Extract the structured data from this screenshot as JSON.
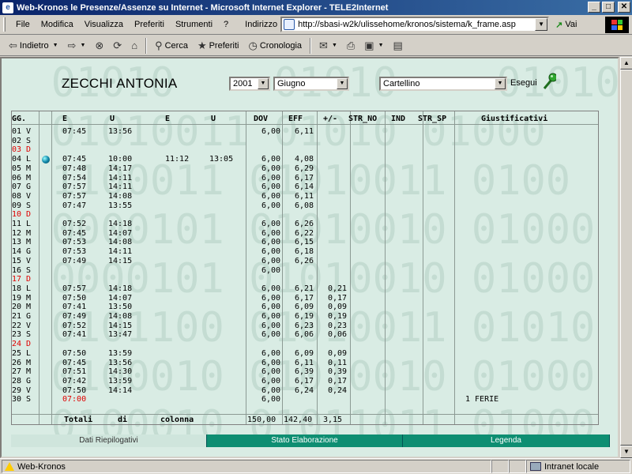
{
  "window": {
    "title": "Web-Kronos le Presenze/Assenze su Internet - Microsoft Internet Explorer - TELE2Internet",
    "min": "_",
    "max": "□",
    "close": "✕"
  },
  "menu": {
    "items": [
      "File",
      "Modifica",
      "Visualizza",
      "Preferiti",
      "Strumenti",
      "?"
    ],
    "address_label": "Indirizzo",
    "address_value": "http://sbasi-w2k/ulissehome/kronos/sistema/k_frame.asp",
    "go_label": "Vai"
  },
  "toolbar": {
    "back": "Indietro",
    "search": "Cerca",
    "favorites": "Preferiti",
    "history": "Cronologia"
  },
  "header": {
    "employee": "ZECCHI ANTONIA",
    "year": "2001",
    "month": "Giugno",
    "report": "Cartellino",
    "run": "Esegui"
  },
  "columns": [
    "GG.",
    "E",
    "U",
    "E",
    "U",
    "DOV",
    "EFF",
    "+/-",
    "STR_NO",
    "IND",
    "STR_SP",
    "Giustificativi"
  ],
  "rows": [
    {
      "gg": "01 V",
      "red": false,
      "e1": "07:45",
      "u1": "13:56",
      "e2": "",
      "u2": "",
      "dov": "6,00",
      "eff": "6,11",
      "diff": "",
      "giust": ""
    },
    {
      "gg": "02 S",
      "red": false,
      "e1": "",
      "u1": "",
      "e2": "",
      "u2": "",
      "dov": "",
      "eff": "",
      "diff": "",
      "giust": ""
    },
    {
      "gg": "03 D",
      "red": true,
      "e1": "",
      "u1": "",
      "e2": "",
      "u2": "",
      "dov": "",
      "eff": "",
      "diff": "",
      "giust": ""
    },
    {
      "gg": "04 L",
      "red": false,
      "icon": true,
      "e1": "07:45",
      "u1": "10:00",
      "e2": "11:12",
      "u2": "13:05",
      "dov": "6,00",
      "eff": "4,08",
      "diff": "",
      "giust": ""
    },
    {
      "gg": "05 M",
      "red": false,
      "e1": "07:48",
      "u1": "14:17",
      "e2": "",
      "u2": "",
      "dov": "6,00",
      "eff": "6,29",
      "diff": "",
      "giust": ""
    },
    {
      "gg": "06 M",
      "red": false,
      "e1": "07:54",
      "u1": "14:11",
      "e2": "",
      "u2": "",
      "dov": "6,00",
      "eff": "6,17",
      "diff": "",
      "giust": ""
    },
    {
      "gg": "07 G",
      "red": false,
      "e1": "07:57",
      "u1": "14:11",
      "e2": "",
      "u2": "",
      "dov": "6,00",
      "eff": "6,14",
      "diff": "",
      "giust": ""
    },
    {
      "gg": "08 V",
      "red": false,
      "e1": "07:57",
      "u1": "14:08",
      "e2": "",
      "u2": "",
      "dov": "6,00",
      "eff": "6,11",
      "diff": "",
      "giust": ""
    },
    {
      "gg": "09 S",
      "red": false,
      "e1": "07:47",
      "u1": "13:55",
      "e2": "",
      "u2": "",
      "dov": "6,00",
      "eff": "6,08",
      "diff": "",
      "giust": ""
    },
    {
      "gg": "10 D",
      "red": true,
      "e1": "",
      "u1": "",
      "e2": "",
      "u2": "",
      "dov": "",
      "eff": "",
      "diff": "",
      "giust": ""
    },
    {
      "gg": "11 L",
      "red": false,
      "e1": "07:52",
      "u1": "14:18",
      "e2": "",
      "u2": "",
      "dov": "6,00",
      "eff": "6,26",
      "diff": "",
      "giust": ""
    },
    {
      "gg": "12 M",
      "red": false,
      "e1": "07:45",
      "u1": "14:07",
      "e2": "",
      "u2": "",
      "dov": "6,00",
      "eff": "6,22",
      "diff": "",
      "giust": ""
    },
    {
      "gg": "13 M",
      "red": false,
      "e1": "07:53",
      "u1": "14:08",
      "e2": "",
      "u2": "",
      "dov": "6,00",
      "eff": "6,15",
      "diff": "",
      "giust": ""
    },
    {
      "gg": "14 G",
      "red": false,
      "e1": "07:53",
      "u1": "14:11",
      "e2": "",
      "u2": "",
      "dov": "6,00",
      "eff": "6,18",
      "diff": "",
      "giust": ""
    },
    {
      "gg": "15 V",
      "red": false,
      "e1": "07:49",
      "u1": "14:15",
      "e2": "",
      "u2": "",
      "dov": "6,00",
      "eff": "6,26",
      "diff": "",
      "giust": ""
    },
    {
      "gg": "16 S",
      "red": false,
      "e1": "",
      "u1": "",
      "e2": "",
      "u2": "",
      "dov": "6,00",
      "eff": "",
      "diff": "",
      "giust": ""
    },
    {
      "gg": "17 D",
      "red": true,
      "e1": "",
      "u1": "",
      "e2": "",
      "u2": "",
      "dov": "",
      "eff": "",
      "diff": "",
      "giust": ""
    },
    {
      "gg": "18 L",
      "red": false,
      "e1": "07:57",
      "u1": "14:18",
      "e2": "",
      "u2": "",
      "dov": "6,00",
      "eff": "6,21",
      "diff": "0,21",
      "giust": ""
    },
    {
      "gg": "19 M",
      "red": false,
      "e1": "07:50",
      "u1": "14:07",
      "e2": "",
      "u2": "",
      "dov": "6,00",
      "eff": "6,17",
      "diff": "0,17",
      "giust": ""
    },
    {
      "gg": "20 M",
      "red": false,
      "e1": "07:41",
      "u1": "13:50",
      "e2": "",
      "u2": "",
      "dov": "6,00",
      "eff": "6,09",
      "diff": "0,09",
      "giust": ""
    },
    {
      "gg": "21 G",
      "red": false,
      "e1": "07:49",
      "u1": "14:08",
      "e2": "",
      "u2": "",
      "dov": "6,00",
      "eff": "6,19",
      "diff": "0,19",
      "giust": ""
    },
    {
      "gg": "22 V",
      "red": false,
      "e1": "07:52",
      "u1": "14:15",
      "e2": "",
      "u2": "",
      "dov": "6,00",
      "eff": "6,23",
      "diff": "0,23",
      "giust": ""
    },
    {
      "gg": "23 S",
      "red": false,
      "e1": "07:41",
      "u1": "13:47",
      "e2": "",
      "u2": "",
      "dov": "6,00",
      "eff": "6,06",
      "diff": "0,06",
      "giust": ""
    },
    {
      "gg": "24 D",
      "red": true,
      "e1": "",
      "u1": "",
      "e2": "",
      "u2": "",
      "dov": "",
      "eff": "",
      "diff": "",
      "giust": ""
    },
    {
      "gg": "25 L",
      "red": false,
      "e1": "07:50",
      "u1": "13:59",
      "e2": "",
      "u2": "",
      "dov": "6,00",
      "eff": "6,09",
      "diff": "0,09",
      "giust": ""
    },
    {
      "gg": "26 M",
      "red": false,
      "e1": "07:45",
      "u1": "13:56",
      "e2": "",
      "u2": "",
      "dov": "6,00",
      "eff": "6,11",
      "diff": "0,11",
      "giust": ""
    },
    {
      "gg": "27 M",
      "red": false,
      "e1": "07:51",
      "u1": "14:30",
      "e2": "",
      "u2": "",
      "dov": "6,00",
      "eff": "6,39",
      "diff": "0,39",
      "giust": ""
    },
    {
      "gg": "28 G",
      "red": false,
      "e1": "07:42",
      "u1": "13:59",
      "e2": "",
      "u2": "",
      "dov": "6,00",
      "eff": "6,17",
      "diff": "0,17",
      "giust": ""
    },
    {
      "gg": "29 V",
      "red": false,
      "e1": "07:50",
      "u1": "14:14",
      "e2": "",
      "u2": "",
      "dov": "6,00",
      "eff": "6,24",
      "diff": "0,24",
      "giust": ""
    },
    {
      "gg": "30 S",
      "red": false,
      "e1": "07:00",
      "e1red": true,
      "u1": "",
      "e2": "",
      "u2": "",
      "dov": "6,00",
      "eff": "",
      "diff": "",
      "giust": "1   FERIE"
    }
  ],
  "totals": {
    "label1": "Totali",
    "label2": "di",
    "label3": "colonna",
    "dov": "150,00",
    "eff": "142,40",
    "diff": "3,15"
  },
  "tabs": [
    "Dati Riepilogativi",
    "Stato Elaborazione",
    "Legenda"
  ],
  "status": {
    "text": "Web-Kronos",
    "zone": "Intranet locale"
  },
  "colors": {
    "page_bg": "#d9ece4",
    "tab_active": "#cfe5dc",
    "tab": "#0e8e72",
    "holiday": "#e00000",
    "titlebar": "#0a246a"
  }
}
